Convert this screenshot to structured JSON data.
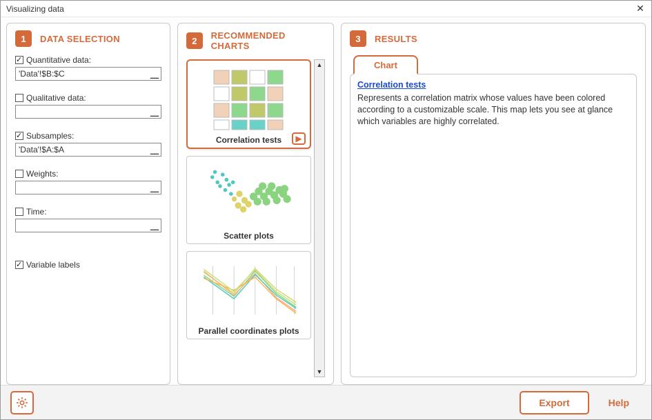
{
  "window": {
    "title": "Visualizing data"
  },
  "panels": {
    "selection": {
      "step": "1",
      "title": "DATA SELECTION"
    },
    "charts": {
      "step": "2",
      "title": "RECOMMENDED CHARTS"
    },
    "results": {
      "step": "3",
      "title": "RESULTS"
    }
  },
  "fields": {
    "quantitative": {
      "label": "Quantitative data:",
      "value": "'Data'!$B:$C",
      "checked": true
    },
    "qualitative": {
      "label": "Qualitative data:",
      "value": "",
      "checked": false
    },
    "subsamples": {
      "label": "Subsamples:",
      "value": "'Data'!$A:$A",
      "checked": true
    },
    "weights": {
      "label": "Weights:",
      "value": "",
      "checked": false
    },
    "time": {
      "label": "Time:",
      "value": "",
      "checked": false
    },
    "varlabels": {
      "label": "Variable labels",
      "checked": true
    }
  },
  "charts": {
    "correlation": {
      "caption": "Correlation tests",
      "selected": true
    },
    "scatter": {
      "caption": "Scatter plots",
      "selected": false
    },
    "parallel": {
      "caption": "Parallel coordinates plots",
      "selected": false
    }
  },
  "results": {
    "tab": "Chart",
    "link": "Correlation tests",
    "desc": "Represents a correlation matrix whose values have been colored according to a customizable scale. This map lets you see at glance which variables are highly correlated."
  },
  "footer": {
    "export": "Export",
    "help": "Help"
  }
}
